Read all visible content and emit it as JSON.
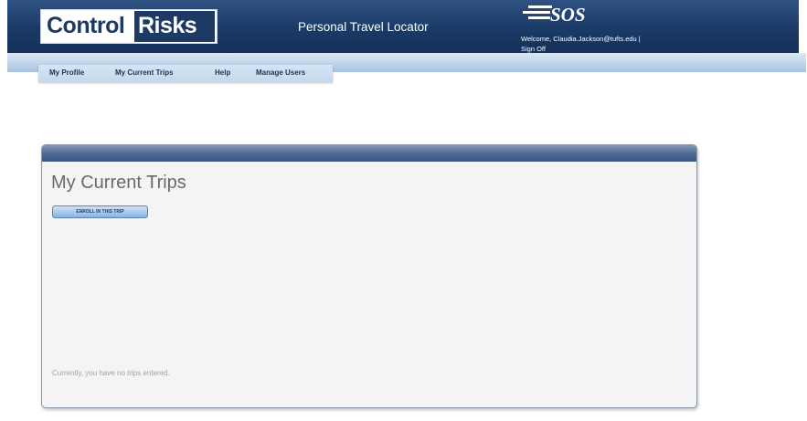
{
  "header": {
    "logo_control": "Control",
    "logo_risks": "Risks",
    "app_title": "Personal Travel Locator",
    "sos_logo_text": "SOS",
    "welcome": "Welcome, Claudia.Jackson@tufts.edu |",
    "sign_off": "Sign Off"
  },
  "nav": {
    "items": [
      "My Profile",
      "My Current Trips",
      "Help",
      "Manage Users"
    ]
  },
  "main": {
    "title": "My Current Trips",
    "add_trip_button": "ENROLL IN THIS TRIP",
    "empty_message": "Currently, you have no trips entered."
  },
  "colors": {
    "header_bg": "#1b3a66",
    "nav_text": "#1f3151",
    "panel_header": "#4b6993",
    "panel_bg": "#f4f4f4",
    "title_text": "#6a6a6a",
    "muted_text": "#a3a3a3"
  }
}
